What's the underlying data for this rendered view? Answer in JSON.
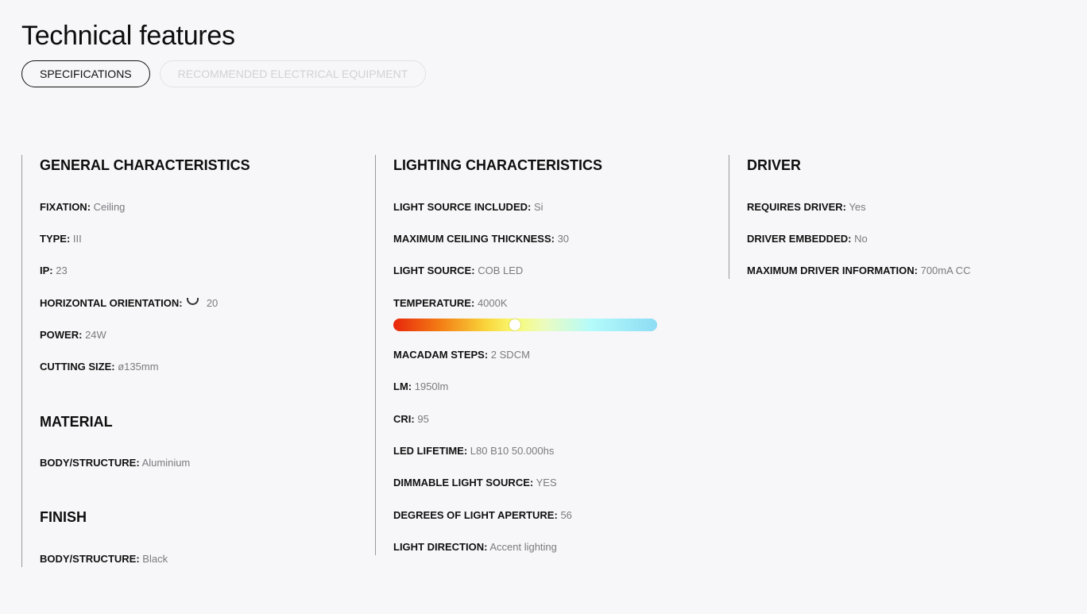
{
  "page": {
    "title": "Technical features"
  },
  "tabs": [
    {
      "label": "SPECIFICATIONS",
      "active": true
    },
    {
      "label": "RECOMMENDED ELECTRICAL EQUIPMENT",
      "active": false
    }
  ],
  "general": {
    "title": "GENERAL CHARACTERISTICS",
    "rows": [
      {
        "label": "FIXATION:",
        "value": "Ceiling"
      },
      {
        "label": "TYPE:",
        "value": "III"
      },
      {
        "label": "IP:",
        "value": "23"
      },
      {
        "label": "HORIZONTAL ORIENTATION:",
        "icon": "rotation-arc-icon",
        "value": "20"
      },
      {
        "label": "POWER:",
        "value": "24W"
      },
      {
        "label": "CUTTING SIZE:",
        "value": "ø135mm"
      }
    ]
  },
  "material": {
    "title": "MATERIAL",
    "rows": [
      {
        "label": "BODY/STRUCTURE:",
        "value": "Aluminium"
      }
    ]
  },
  "finish": {
    "title": "FINISH",
    "rows": [
      {
        "label": "BODY/STRUCTURE:",
        "value": "Black"
      }
    ]
  },
  "lighting": {
    "title": "LIGHTING CHARACTERISTICS",
    "rows": [
      {
        "label": "LIGHT SOURCE INCLUDED:",
        "value": "Si"
      },
      {
        "label": "MAXIMUM CEILING THICKNESS:",
        "value": "30"
      },
      {
        "label": "LIGHT SOURCE:",
        "value": "COB LED"
      },
      {
        "label": "TEMPERATURE:",
        "value": "4000K"
      },
      {
        "label": "MACADAM STEPS:",
        "value": "2 SDCM"
      },
      {
        "label": "LM:",
        "value": "1950lm"
      },
      {
        "label": "CRI:",
        "value": "95"
      },
      {
        "label": "LED LIFETIME:",
        "value": "L80 B10 50.000hs"
      },
      {
        "label": "DIMMABLE LIGHT SOURCE:",
        "value": "YES"
      },
      {
        "label": "DEGREES OF LIGHT APERTURE:",
        "value": "56"
      },
      {
        "label": "LIGHT DIRECTION:",
        "value": "Accent lighting"
      }
    ],
    "temperature_scale": {
      "position_fraction": 0.46
    }
  },
  "driver": {
    "title": "DRIVER",
    "rows": [
      {
        "label": "REQUIRES DRIVER:",
        "value": "Yes"
      },
      {
        "label": "DRIVER EMBEDDED:",
        "value": "No"
      },
      {
        "label": "MAXIMUM DRIVER INFORMATION:",
        "value": "700mA CC"
      }
    ]
  },
  "colors": {
    "background": "#f7f7f9",
    "label": "#111111",
    "value": "#7a7a80",
    "divider": "#9a9a9a",
    "inactive_tab_text": "#d2d2d6"
  }
}
